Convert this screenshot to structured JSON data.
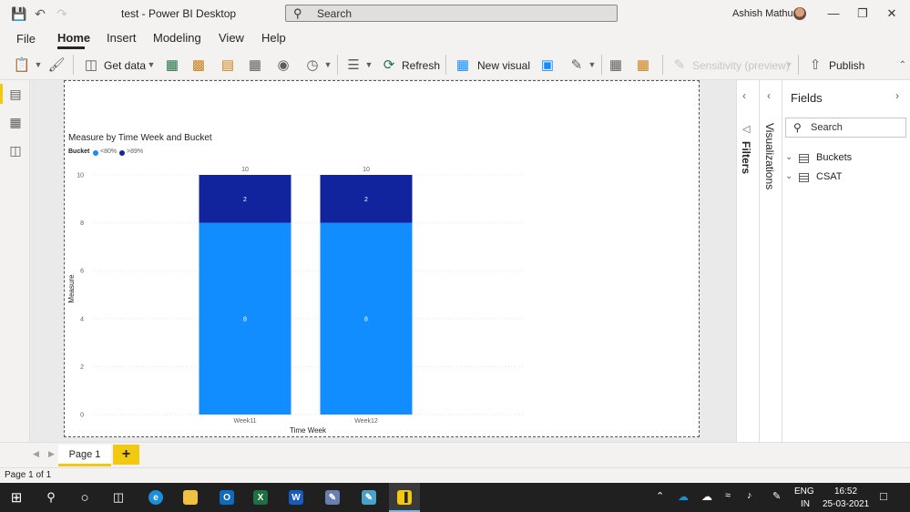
{
  "titlebar": {
    "app_title": "test - Power BI Desktop",
    "search_placeholder": "Search",
    "user_name": "Ashish Mathur"
  },
  "ribbon_tabs": [
    "File",
    "Home",
    "Insert",
    "Modeling",
    "View",
    "Help"
  ],
  "ribbon": {
    "get_data": "Get data",
    "refresh": "Refresh",
    "new_visual": "New visual",
    "sensitivity": "Sensitivity (preview)",
    "publish": "Publish"
  },
  "panes": {
    "filters": "Filters",
    "visualizations": "Visualizations",
    "fields_title": "Fields",
    "fields_search": "Search",
    "tables": [
      "Buckets",
      "CSAT"
    ]
  },
  "page_tabs": {
    "page1": "Page 1",
    "add": "+"
  },
  "status": "Page 1 of 1",
  "taskbar": {
    "lang_top": "ENG",
    "lang_bottom": "IN",
    "time": "16:52",
    "date": "25-03-2021"
  },
  "colors": {
    "accent": "#f2c811",
    "series_low": "#118dff",
    "series_high": "#12239e"
  },
  "chart_data": {
    "type": "bar",
    "stacked": true,
    "title": "Measure by Time Week and Bucket",
    "legend_title": "Bucket",
    "legend_position": "top-left",
    "xlabel": "Time Week",
    "ylabel": "Measure",
    "categories": [
      "Week11",
      "Week12"
    ],
    "ylim": [
      0,
      10
    ],
    "yticks": [
      "0",
      "2",
      "4",
      "6",
      "8",
      "10"
    ],
    "grid": true,
    "series": [
      {
        "name": "<80%",
        "values": [
          8,
          8
        ],
        "color": "#118dff"
      },
      {
        "name": ">89%",
        "values": [
          2,
          2
        ],
        "color": "#12239e"
      }
    ],
    "totals": [
      10,
      10
    ]
  }
}
